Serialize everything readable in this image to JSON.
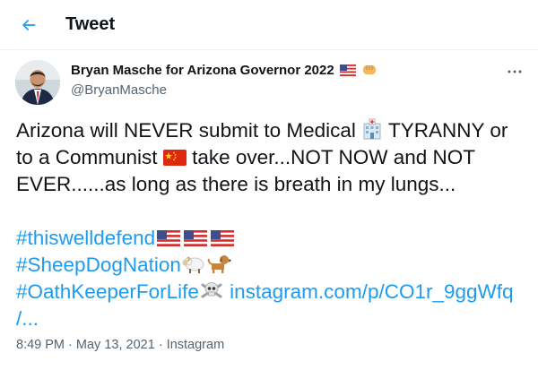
{
  "header": {
    "title": "Tweet"
  },
  "author": {
    "name": "Bryan Masche for Arizona Governor 2022",
    "handle": "@BryanMasche",
    "name_emojis": [
      "us-flag-icon",
      "fist-icon"
    ]
  },
  "tweet": {
    "line1_a": "Arizona will NEVER submit to Medical ",
    "line1_b": " TYRANNY or",
    "line2_a": "to a Communist ",
    "line2_b": " take over...NOT NOW and NOT",
    "line3": "EVER......as long as there is breath in my lungs...",
    "hashtag1": "#thiswelldefend",
    "hashtag2": "#SheepDogNation",
    "hashtag3": "#OathKeeperForLife",
    "link_text": "instagram.com/p/CO1r_9ggWfq",
    "link_cont": "/..."
  },
  "meta": {
    "time": "8:49 PM",
    "separator": "·",
    "date": "May 13, 2021",
    "source": "Instagram"
  },
  "colors": {
    "accent": "#1d9bf0",
    "text": "#0f1419",
    "muted": "#536471",
    "border": "#eff3f4"
  }
}
